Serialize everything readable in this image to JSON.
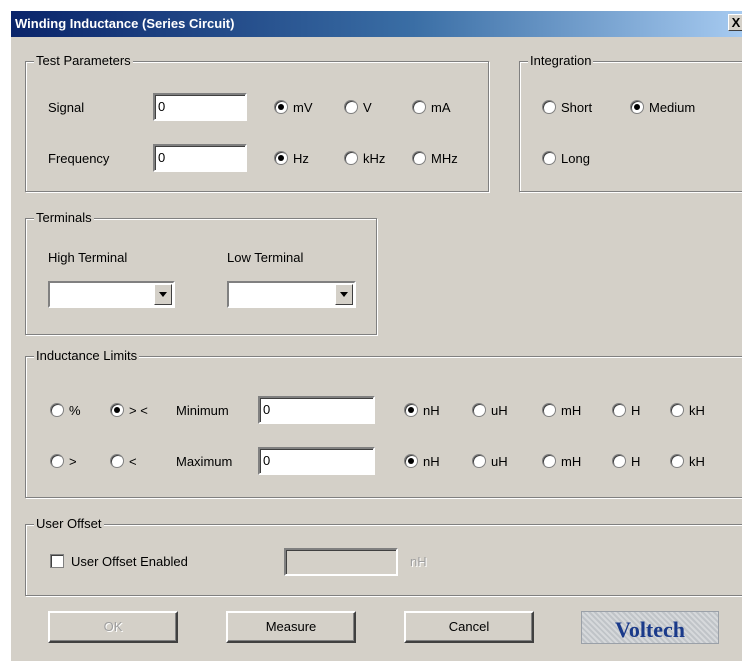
{
  "window": {
    "title": "Winding Inductance (Series Circuit)",
    "close_label": "X"
  },
  "test_parameters": {
    "legend": "Test Parameters",
    "signal": {
      "label": "Signal",
      "value": "0",
      "units": [
        "mV",
        "V",
        "mA"
      ],
      "selected": "mV"
    },
    "frequency": {
      "label": "Frequency",
      "value": "0",
      "units": [
        "Hz",
        "kHz",
        "MHz"
      ],
      "selected": "Hz"
    }
  },
  "integration": {
    "legend": "Integration",
    "options": [
      "Short",
      "Medium",
      "Long"
    ],
    "selected": "Medium"
  },
  "terminals": {
    "legend": "Terminals",
    "high_label": "High Terminal",
    "high_value": "",
    "low_label": "Low Terminal",
    "low_value": ""
  },
  "inductance_limits": {
    "legend": "Inductance Limits",
    "mode_options": [
      "%",
      "> <",
      ">",
      "<"
    ],
    "mode_selected": "> <",
    "minimum": {
      "label": "Minimum",
      "value": "0",
      "units": [
        "nH",
        "uH",
        "mH",
        "H",
        "kH"
      ],
      "selected": "nH"
    },
    "maximum": {
      "label": "Maximum",
      "value": "0",
      "units": [
        "nH",
        "uH",
        "mH",
        "H",
        "kH"
      ],
      "selected": "nH"
    }
  },
  "user_offset": {
    "legend": "User Offset",
    "checkbox_label": "User Offset Enabled",
    "checked": false,
    "value": "",
    "unit": "nH"
  },
  "buttons": {
    "ok": "OK",
    "measure": "Measure",
    "cancel": "Cancel"
  },
  "logo": {
    "text": "Voltech"
  },
  "colors": {
    "titlebar_start": "#0a246a",
    "titlebar_end": "#a6caf0",
    "face": "#d4d0c8",
    "logo_text": "#1a3a8a"
  }
}
